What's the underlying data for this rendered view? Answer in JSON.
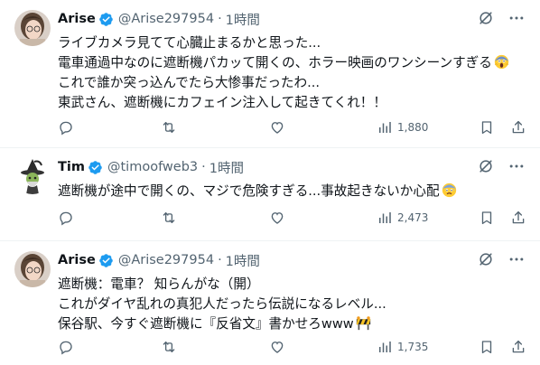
{
  "colors": {
    "text": "#0f1419",
    "secondary": "#536471",
    "verified": "#1d9bf0",
    "divider": "#eff3f4"
  },
  "tweets": [
    {
      "author": {
        "name": "Arise",
        "handle": "@Arise297954",
        "avatar": "avatar-photo"
      },
      "time": "1時間",
      "lines": [
        "ライブカメラ見てて心臓止まるかと思った...",
        "電車通過中なのに遮断機パカッて開くの、ホラー映画のワンシーンすぎる",
        "これで誰か突っ込んでたら大惨事だったわ...",
        "東武さん、遮断機にカフェイン注入して起きてくれ！！"
      ],
      "emoji": "scream-emoji",
      "views": "1,880"
    },
    {
      "author": {
        "name": "Tim",
        "handle": "@timoofweb3",
        "avatar": "witch-avatar"
      },
      "time": "1時間",
      "lines": [
        "遮断機が途中で開くの、マジで危険すぎる...事故起きないか心配"
      ],
      "emoji": "anxious-emoji",
      "views": "2,473"
    },
    {
      "author": {
        "name": "Arise",
        "handle": "@Arise297954",
        "avatar": "avatar-photo"
      },
      "time": "1時間",
      "lines": [
        "遮断機：電車？ 知らんがな（開）",
        "これがダイヤ乱れの真犯人だったら伝説になるレベル...",
        "保谷駅、今すぐ遮断機に『反省文』書かせろwww"
      ],
      "emoji": "construction-emoji",
      "views": "1,735"
    }
  ]
}
